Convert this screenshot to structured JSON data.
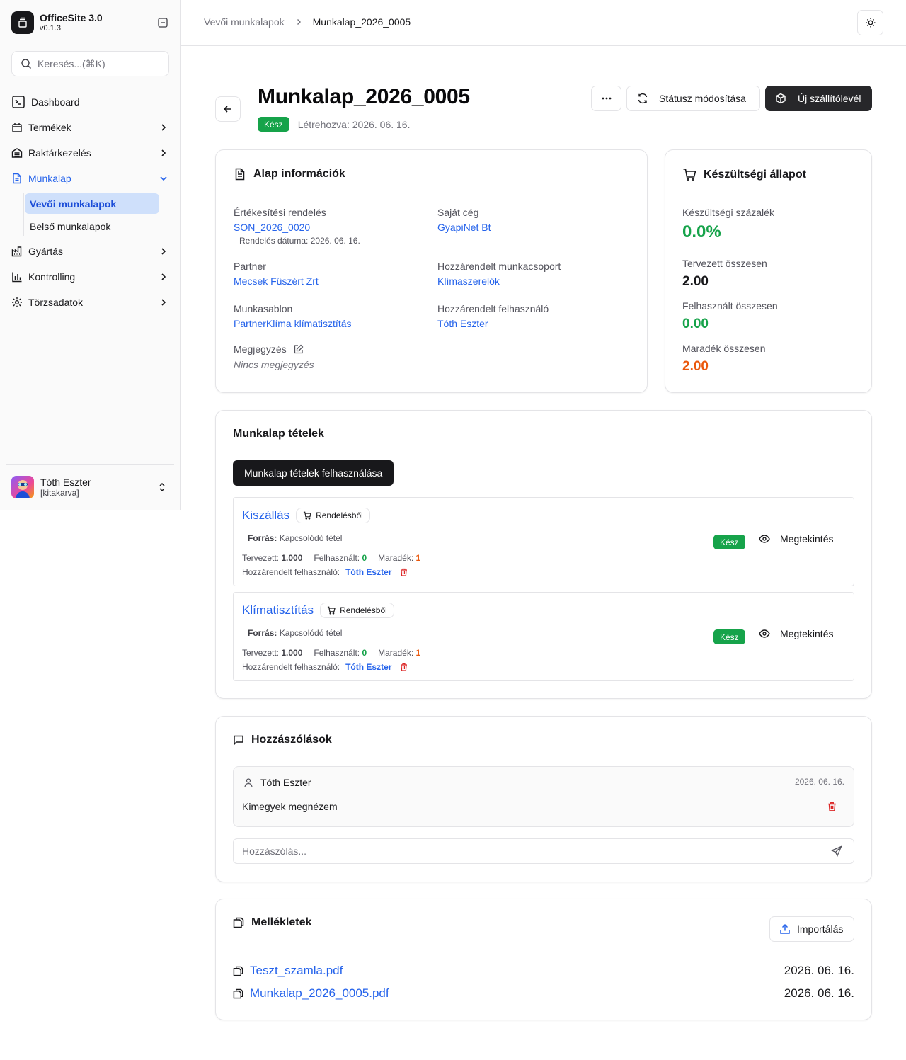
{
  "app": {
    "name": "OfficeSite 3.0",
    "version": "v0.1.3"
  },
  "search": {
    "placeholder": "Keresés...(⌘K)"
  },
  "sidebar": {
    "items": [
      {
        "label": "Dashboard"
      },
      {
        "label": "Termékek"
      },
      {
        "label": "Raktárkezelés"
      },
      {
        "label": "Munkalap"
      },
      {
        "label": "Gyártás"
      },
      {
        "label": "Kontrolling"
      },
      {
        "label": "Törzsadatok"
      }
    ],
    "subitems": [
      {
        "label": "Vevői munkalapok"
      },
      {
        "label": "Belső munkalapok"
      }
    ],
    "user": {
      "name": "Tóth Eszter",
      "role": "[kitakarva]"
    }
  },
  "breadcrumb": {
    "parent": "Vevői munkalapok",
    "current": "Munkalap_2026_0005"
  },
  "page": {
    "title": "Munkalap_2026_0005",
    "status": "Kész",
    "created": "Létrehozva: 2026. 06. 16.",
    "actions": {
      "more": "···",
      "status_change": "Státusz módosítása",
      "new_delivery": "Új szállítólevél"
    }
  },
  "basic_info": {
    "title": "Alap információk",
    "sales_order_label": "Értékesítési rendelés",
    "sales_order_value": "SON_2026_0020",
    "order_date": "Rendelés dátuma: 2026. 06. 16.",
    "own_company_label": "Saját cég",
    "own_company_value": "GyapiNet Bt",
    "partner_label": "Partner",
    "partner_value": "Mecsek Füszért Zrt",
    "workgroup_label": "Hozzárendelt munkacsoport",
    "workgroup_value": "Klímaszerelők",
    "template_label": "Munkasablon",
    "template_value": "PartnerKlíma klímatisztítás",
    "assigned_user_label": "Hozzárendelt felhasználó",
    "assigned_user_value": "Tóth Eszter",
    "note_label": "Megjegyzés",
    "note_value": "Nincs megjegyzés"
  },
  "progress": {
    "title": "Készültségi állapot",
    "percent_label": "Készültségi százalék",
    "percent_value": "0.0%",
    "planned_label": "Tervezett összesen",
    "planned_value": "2.00",
    "used_label": "Felhasznált összesen",
    "used_value": "0.00",
    "remaining_label": "Maradék összesen",
    "remaining_value": "2.00"
  },
  "items_section": {
    "title": "Munkalap tételek",
    "use_button": "Munkalap tételek felhasználása",
    "items": [
      {
        "name": "Kiszállás",
        "tag": "Rendelésből",
        "source_label": "Forrás:",
        "source_value": "Kapcsolódó tétel",
        "planned_label": "Tervezett:",
        "planned": "1.000",
        "used_label": "Felhasznált:",
        "used": "0",
        "remaining_label": "Maradék:",
        "remaining": "1",
        "user_label": "Hozzárendelt felhasználó:",
        "user": "Tóth Eszter",
        "status": "Kész",
        "view": "Megtekintés"
      },
      {
        "name": "Klímatisztítás",
        "tag": "Rendelésből",
        "source_label": "Forrás:",
        "source_value": "Kapcsolódó tétel",
        "planned_label": "Tervezett:",
        "planned": "1.000",
        "used_label": "Felhasznált:",
        "used": "0",
        "remaining_label": "Maradék:",
        "remaining": "1",
        "user_label": "Hozzárendelt felhasználó:",
        "user": "Tóth Eszter",
        "status": "Kész",
        "view": "Megtekintés"
      }
    ]
  },
  "comments": {
    "title": "Hozzászólások",
    "entries": [
      {
        "author": "Tóth Eszter",
        "date": "2026. 06. 16.",
        "text": "Kimegyek megnézem"
      }
    ],
    "input_placeholder": "Hozzászólás..."
  },
  "attachments": {
    "title": "Mellékletek",
    "import_button": "Importálás",
    "files": [
      {
        "name": "Teszt_szamla.pdf",
        "date": "2026. 06. 16."
      },
      {
        "name": "Munkalap_2026_0005.pdf",
        "date": "2026. 06. 16."
      }
    ]
  },
  "colors": {
    "accent": "#2563eb",
    "success": "#16a34a",
    "danger": "#dc2626",
    "warning": "#ea580c",
    "dark": "#18181b"
  }
}
